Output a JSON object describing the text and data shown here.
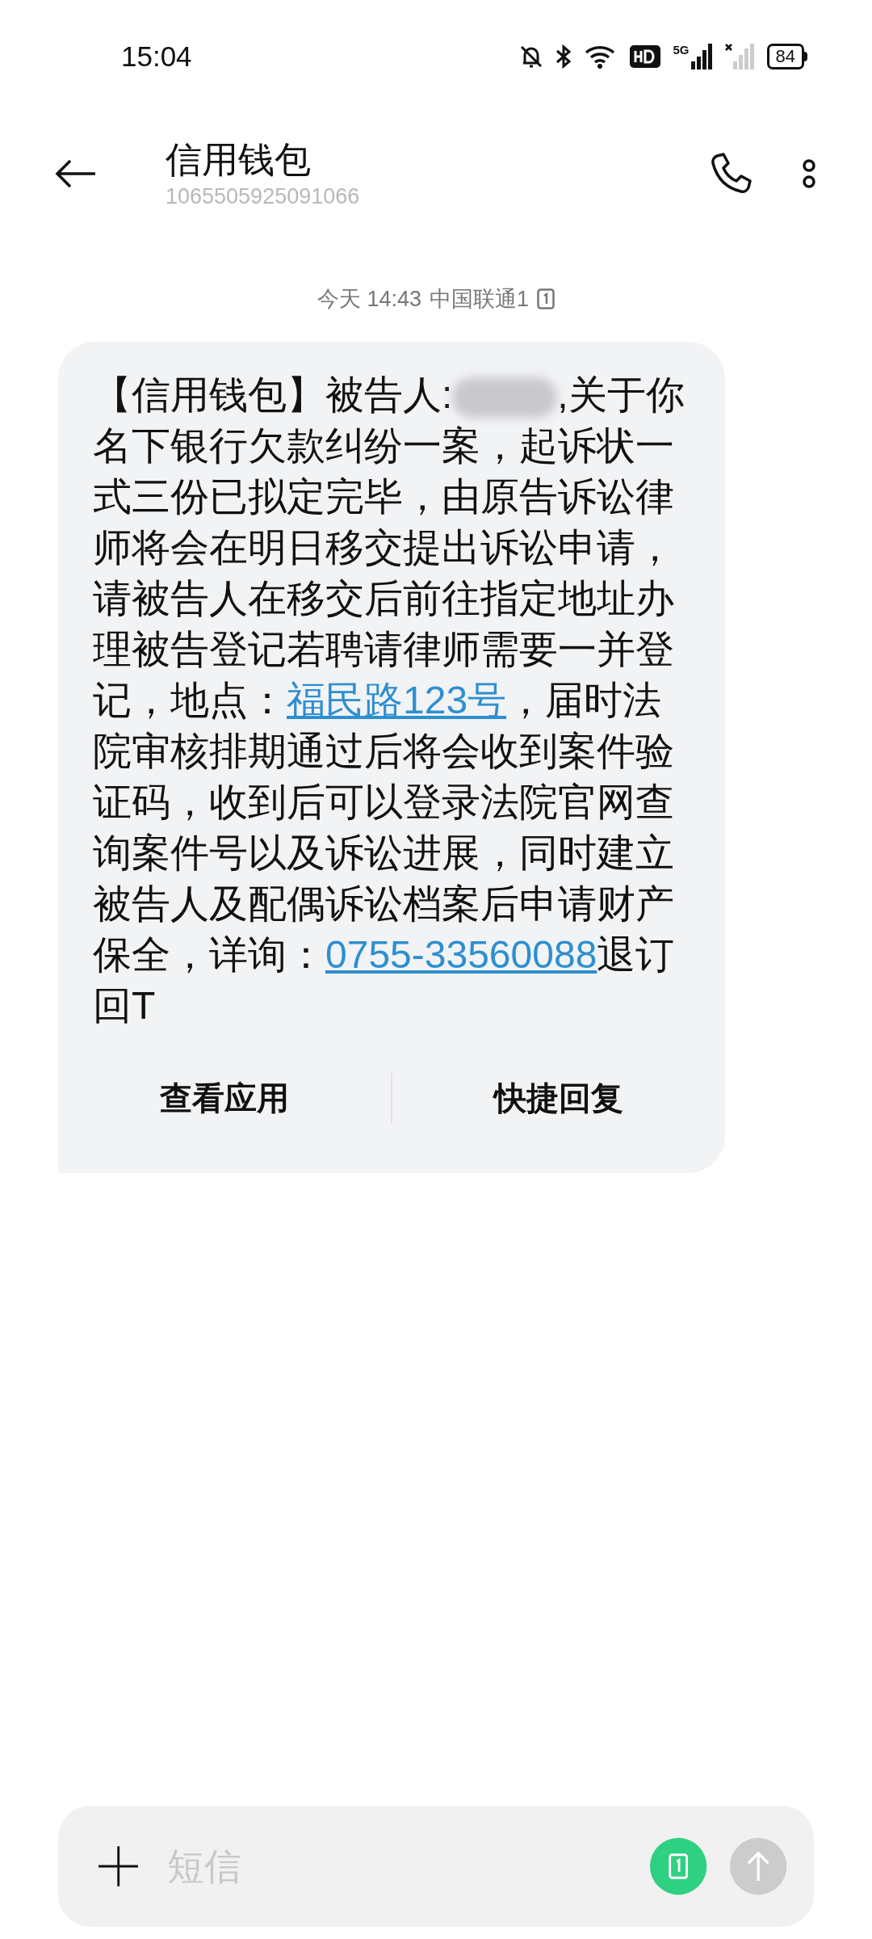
{
  "status_bar": {
    "time": "15:04",
    "network": "5G",
    "battery": "84"
  },
  "header": {
    "title": "信用钱包",
    "number": "1065505925091066"
  },
  "timestamp": {
    "time": "今天 14:43",
    "carrier": "中国联通1"
  },
  "message": {
    "segments": [
      {
        "kind": "text",
        "text": "【信用钱包】被告人:"
      },
      {
        "kind": "redacted"
      },
      {
        "kind": "text",
        "text": ",关于你名下银行欠款纠纷一案，起诉状一式三份已拟定完毕，由原告诉讼律师将会在明日移交提出诉讼申请，请被告人在移交后前往指定地址办理被告登记若聘请律师需要一并登记，地点："
      },
      {
        "kind": "link",
        "text": "福民路123号"
      },
      {
        "kind": "text",
        "text": "，届时法院审核排期通过后将会收到案件验证码，收到后可以登录法院官网查询案件号以及诉讼进展，同时建立被告人及配偶诉讼档案后申请财产保全，详询："
      },
      {
        "kind": "link",
        "text": "0755-33560088"
      },
      {
        "kind": "text",
        "text": "退订回T"
      }
    ],
    "actions": [
      "查看应用",
      "快捷回复"
    ]
  },
  "composer": {
    "placeholder": "短信"
  }
}
